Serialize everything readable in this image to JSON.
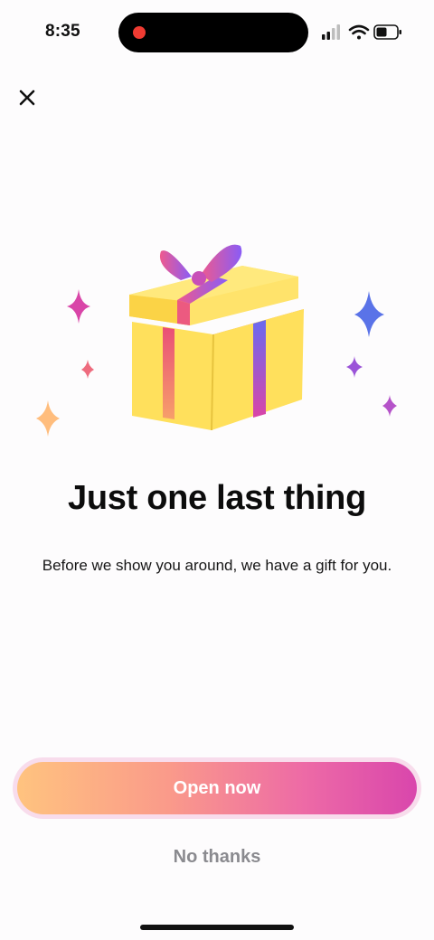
{
  "status_bar": {
    "time": "8:35",
    "icons": [
      "signal-icon",
      "wifi-icon",
      "battery-icon"
    ]
  },
  "close": {
    "icon": "close-icon"
  },
  "hero": {
    "icon": "gift-box-icon",
    "accent_colors": [
      "#ffe05c",
      "#f08a3c",
      "#e94e77",
      "#8a5cf6",
      "#5a73e8",
      "#d945a8",
      "#ffb870"
    ]
  },
  "content": {
    "title": "Just one last thing",
    "subtitle": "Before we show you around, we have a gift for you."
  },
  "actions": {
    "primary_label": "Open now",
    "secondary_label": "No thanks"
  },
  "colors": {
    "background": "#fdfcfd",
    "cta_gradient_start": "#ffc37f",
    "cta_gradient_end": "#d946ac",
    "secondary_text": "#8a8a8f",
    "record_dot": "#ef3b32"
  }
}
